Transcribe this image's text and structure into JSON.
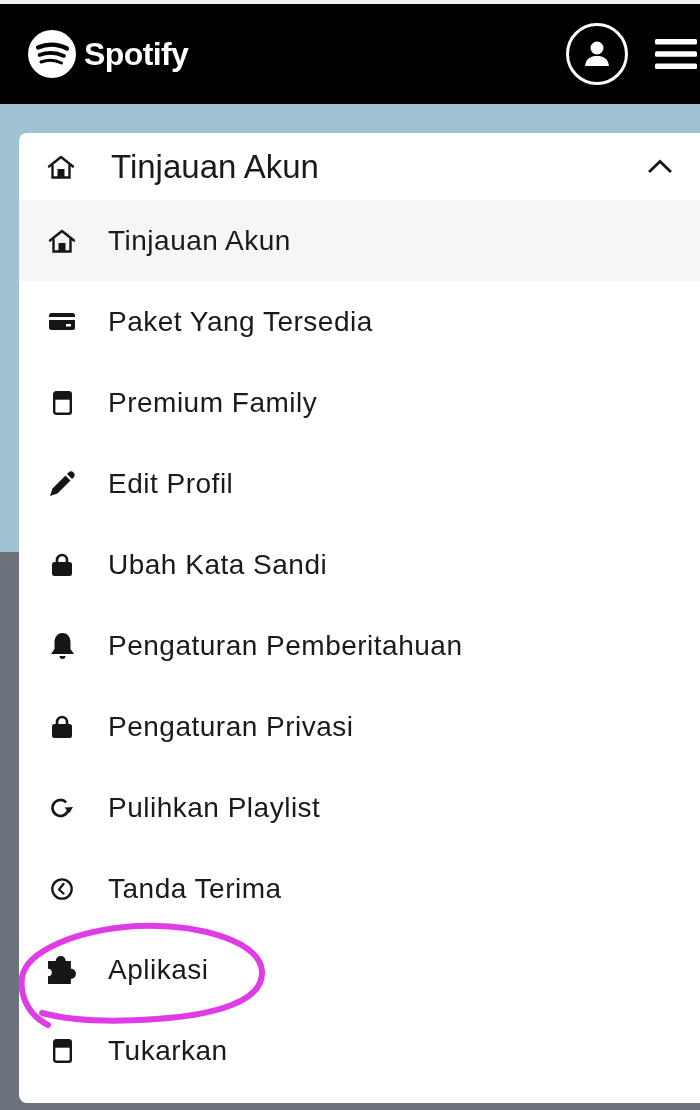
{
  "header": {
    "logo_text": "Spotify"
  },
  "menu": {
    "title": "Tinjauan Akun",
    "expanded": true,
    "items": [
      {
        "label": "Tinjauan Akun",
        "selected": true,
        "circled": false
      },
      {
        "label": "Paket Yang Tersedia",
        "selected": false,
        "circled": false
      },
      {
        "label": "Premium Family",
        "selected": false,
        "circled": false
      },
      {
        "label": "Edit Profil",
        "selected": false,
        "circled": false
      },
      {
        "label": "Ubah Kata Sandi",
        "selected": false,
        "circled": false
      },
      {
        "label": "Pengaturan Pemberitahuan",
        "selected": false,
        "circled": false
      },
      {
        "label": "Pengaturan Privasi",
        "selected": false,
        "circled": false
      },
      {
        "label": "Pulihkan Playlist",
        "selected": false,
        "circled": false
      },
      {
        "label": "Tanda Terima",
        "selected": false,
        "circled": false
      },
      {
        "label": "Aplikasi",
        "selected": false,
        "circled": true
      },
      {
        "label": "Tukarkan",
        "selected": false,
        "circled": false
      }
    ]
  }
}
